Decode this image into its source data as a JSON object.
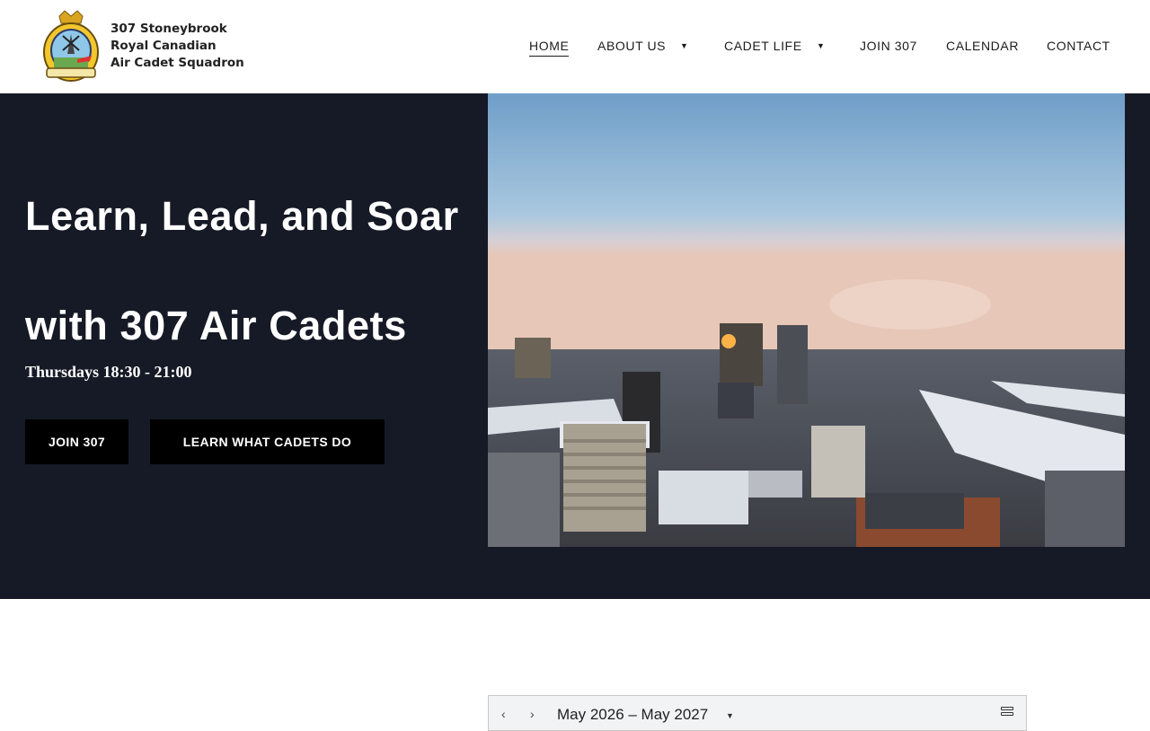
{
  "brand": {
    "lines": [
      "307 Stoneybrook",
      "Royal Canadian",
      "Air Cadet Squadron"
    ]
  },
  "nav": {
    "items": [
      {
        "label": "HOME",
        "active": true
      },
      {
        "label": "ABOUT US",
        "dropdown": true
      },
      {
        "label": "CADET LIFE",
        "dropdown": true
      },
      {
        "label": "JOIN 307"
      },
      {
        "label": "CALENDAR"
      },
      {
        "label": "CONTACT"
      }
    ],
    "caret": "▼"
  },
  "hero": {
    "title_line1": "Learn, Lead, and Soar",
    "title_line2": "with 307 Air Cadets",
    "subtitle": "Thursdays 18:30 - 21:00",
    "buttons": {
      "join": "JOIN 307",
      "learn": "LEARN WHAT CADETS DO"
    }
  },
  "calendar": {
    "prev": "‹",
    "next": "›",
    "range": "May 2026 – May 2027",
    "range_caret": "▼"
  },
  "colors": {
    "hero_bg": "#161a26",
    "button_bg": "#000000",
    "text_dark": "#1b1b1b"
  },
  "icons": [
    "crest-logo",
    "chevron-down-icon",
    "chevron-left-icon",
    "chevron-right-icon",
    "agenda-view-icon"
  ]
}
